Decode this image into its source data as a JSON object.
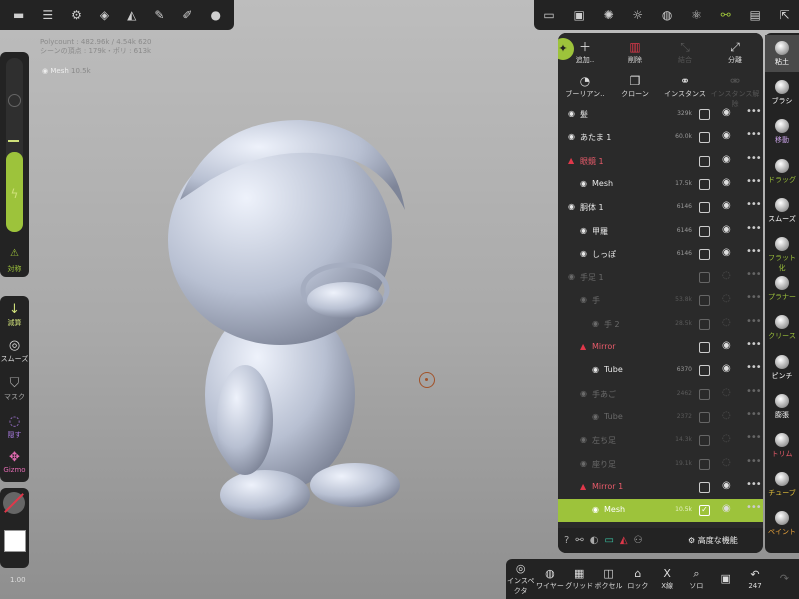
{
  "topleft": {
    "icons": [
      "menu-icon",
      "sliders-icon",
      "settings-icon",
      "layers-icon",
      "symmetry-icon",
      "picker-icon",
      "pen-icon",
      "material-icon"
    ]
  },
  "topright": {
    "icons": [
      "camera-icon",
      "image-icon",
      "aperture-icon",
      "sun-icon",
      "globe-icon",
      "atom-icon",
      "scene-icon",
      "folder-icon",
      "export-icon"
    ]
  },
  "info": {
    "line1": "Polycount : 482.96k / 4.54k 620",
    "line2": "シーンの頂点 : 179k・ポリ : 613k"
  },
  "mesh": {
    "name": "Mesh",
    "count": "10.5k"
  },
  "left_slider": {
    "label": "対称"
  },
  "left_tools": [
    {
      "label": "減算",
      "icon": "arrow-down-icon"
    },
    {
      "label": "スムーズ",
      "icon": "smooth-ball-icon"
    },
    {
      "label": "マスク",
      "icon": "mask-icon"
    },
    {
      "label": "隠す",
      "icon": "hide-icon"
    },
    {
      "label": "Gizmo",
      "icon": "gizmo-icon"
    }
  ],
  "scale": "1.00",
  "scene": {
    "actions": [
      {
        "label": "追加..",
        "icon": "plus-icon"
      },
      {
        "label": "削除",
        "icon": "trash-icon"
      },
      {
        "label": "結合",
        "icon": "merge-icon"
      },
      {
        "label": "分離",
        "icon": "split-icon"
      },
      {
        "label": "ブーリアン..",
        "icon": "boolean-icon"
      },
      {
        "label": "クローン",
        "icon": "clone-icon"
      },
      {
        "label": "インスタンス",
        "icon": "link-icon"
      },
      {
        "label": "インスタンス解除",
        "icon": "unlink-icon"
      }
    ],
    "rows": [
      {
        "name": "髪",
        "count": "329k",
        "checked": false,
        "visible": true,
        "dim": false,
        "red": false
      },
      {
        "name": "あたま 1",
        "count": "60.0k",
        "checked": false,
        "visible": true,
        "dim": false,
        "red": false
      },
      {
        "name": "眼鏡 1",
        "count": "",
        "checked": false,
        "visible": true,
        "dim": false,
        "red": true
      },
      {
        "name": "Mesh",
        "count": "17.5k",
        "checked": false,
        "visible": true,
        "dim": false,
        "red": false
      },
      {
        "name": "胴体 1",
        "count": "6146",
        "checked": false,
        "visible": true,
        "dim": false,
        "red": false
      },
      {
        "name": "甲羅",
        "count": "6146",
        "checked": false,
        "visible": true,
        "dim": false,
        "red": false
      },
      {
        "name": "しっぽ",
        "count": "6146",
        "checked": false,
        "visible": true,
        "dim": false,
        "red": false
      },
      {
        "name": "手足 1",
        "count": "",
        "checked": false,
        "visible": false,
        "dim": true,
        "red": false
      },
      {
        "name": "手",
        "count": "53.8k",
        "checked": false,
        "visible": false,
        "dim": true,
        "red": false
      },
      {
        "name": "手 2",
        "count": "28.5k",
        "checked": false,
        "visible": false,
        "dim": true,
        "red": false
      },
      {
        "name": "Mirror",
        "count": "",
        "checked": false,
        "visible": true,
        "dim": false,
        "red": true
      },
      {
        "name": "Tube",
        "count": "6370",
        "checked": false,
        "visible": true,
        "dim": false,
        "red": false
      },
      {
        "name": "手あご",
        "count": "2462",
        "checked": false,
        "visible": false,
        "dim": true,
        "red": false
      },
      {
        "name": "Tube",
        "count": "2372",
        "checked": false,
        "visible": false,
        "dim": true,
        "red": false
      },
      {
        "name": "左ち足",
        "count": "14.3k",
        "checked": false,
        "visible": false,
        "dim": true,
        "red": false
      },
      {
        "name": "座り足",
        "count": "19.1k",
        "checked": false,
        "visible": false,
        "dim": true,
        "red": false
      },
      {
        "name": "Mirror 1",
        "count": "",
        "checked": false,
        "visible": true,
        "dim": false,
        "red": true
      },
      {
        "name": "Mesh",
        "count": "10.5k",
        "checked": true,
        "visible": true,
        "dim": false,
        "red": false,
        "selected": true
      }
    ],
    "advanced_label": "高度な機能"
  },
  "brushes": [
    {
      "label": "粘土",
      "active": true,
      "color": "#ffffff"
    },
    {
      "label": "ブラシ",
      "active": false,
      "color": "#ffffff"
    },
    {
      "label": "移動",
      "active": false,
      "color": "#c9a3e8"
    },
    {
      "label": "ドラッグ",
      "active": false,
      "color": "#9dc33b"
    },
    {
      "label": "スムーズ",
      "active": false,
      "color": "#ffffff"
    },
    {
      "label": "フラット化",
      "active": false,
      "color": "#9dc33b"
    },
    {
      "label": "プラナー",
      "active": false,
      "color": "#9dc33b"
    },
    {
      "label": "クリース",
      "active": false,
      "color": "#9dc33b"
    },
    {
      "label": "ピンチ",
      "active": false,
      "color": "#ffffff"
    },
    {
      "label": "膨張",
      "active": false,
      "color": "#ffffff"
    },
    {
      "label": "トリム",
      "active": false,
      "color": "#e85b6a"
    },
    {
      "label": "チューブ",
      "active": false,
      "color": "#e8c43b"
    },
    {
      "label": "ペイント",
      "active": false,
      "color": "#e8a33b"
    }
  ],
  "bottom": [
    {
      "label": "インスペクタ",
      "icon": "inspector-icon"
    },
    {
      "label": "ワイヤー",
      "icon": "wire-icon"
    },
    {
      "label": "グリッド",
      "icon": "grid-icon"
    },
    {
      "label": "ボクセル",
      "icon": "voxel-icon"
    },
    {
      "label": "ロック",
      "icon": "lock-icon"
    },
    {
      "label": "X線",
      "icon": "xray-icon"
    },
    {
      "label": "ソロ",
      "icon": "solo-icon"
    },
    {
      "label": "",
      "icon": "save-icon"
    },
    {
      "label": "247",
      "icon": "undo-icon"
    },
    {
      "label": "",
      "icon": "redo-icon"
    }
  ],
  "colors": {
    "accent": "#9dc33b",
    "danger": "#e0384a"
  }
}
